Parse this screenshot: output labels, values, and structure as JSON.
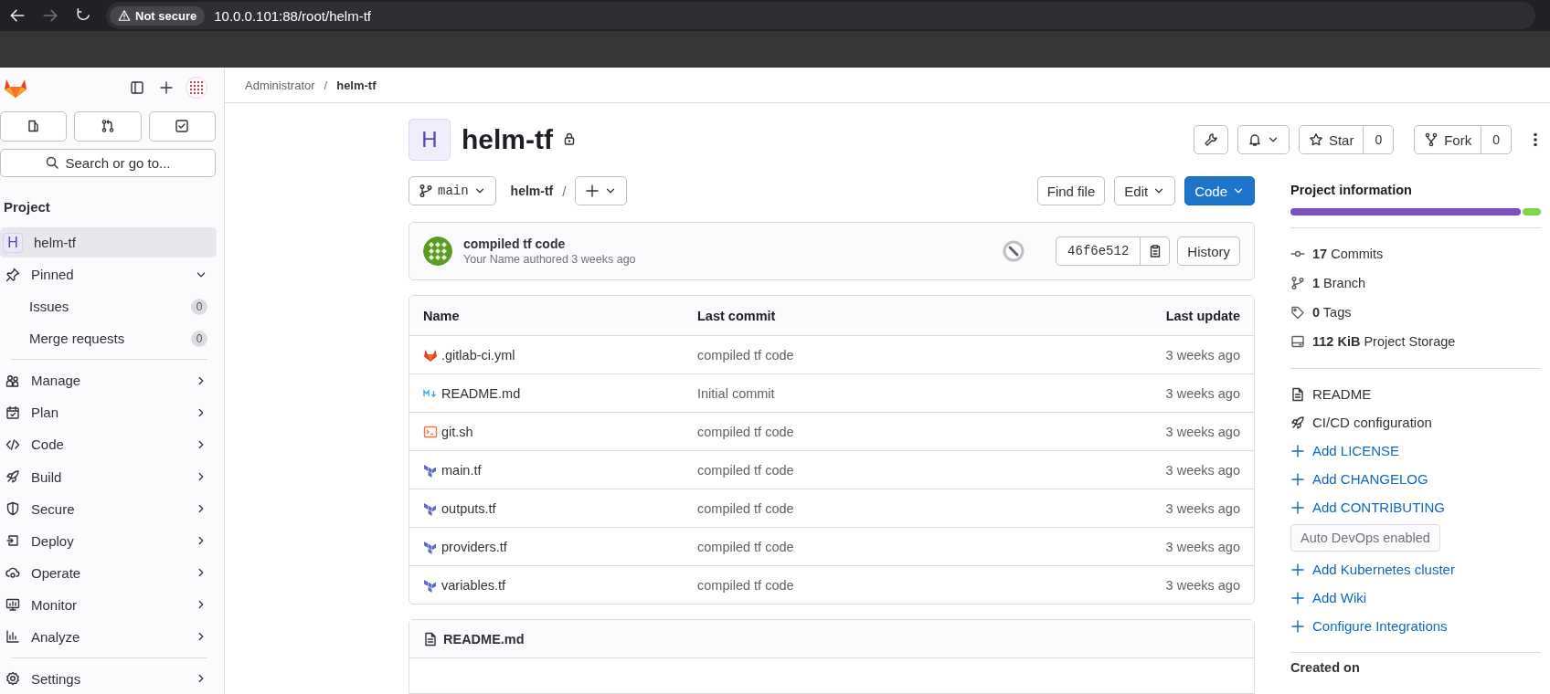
{
  "browser": {
    "nav": [
      {
        "kind": "back",
        "disabled": false
      },
      {
        "kind": "forward",
        "disabled": true
      },
      {
        "kind": "reload",
        "disabled": false
      }
    ],
    "security": "Not secure",
    "url": "10.0.0.101:88/root/helm-tf"
  },
  "sidebar": {
    "search": "Search or go to...",
    "section": "Project",
    "project": {
      "avatar": "H",
      "label": "helm-tf",
      "selected": true
    },
    "pinned": {
      "label": "Pinned",
      "expanded": true,
      "children": [
        {
          "label": "Issues",
          "count": "0"
        },
        {
          "label": "Merge requests",
          "count": "0"
        }
      ]
    },
    "items": [
      {
        "kind": "manage",
        "label": "Manage"
      },
      {
        "kind": "plan",
        "label": "Plan"
      },
      {
        "kind": "code",
        "label": "Code"
      },
      {
        "kind": "build",
        "label": "Build"
      },
      {
        "kind": "secure",
        "label": "Secure"
      },
      {
        "kind": "deploy",
        "label": "Deploy"
      },
      {
        "kind": "operate",
        "label": "Operate"
      },
      {
        "kind": "monitor",
        "label": "Monitor"
      },
      {
        "kind": "analyze",
        "label": "Analyze"
      }
    ],
    "footer": {
      "kind": "settings",
      "label": "Settings"
    }
  },
  "breadcrumb": [
    "Administrator",
    "/",
    "helm-tf"
  ],
  "project": {
    "avatar": "H",
    "name": "helm-tf",
    "private": true,
    "star": {
      "label": "Star",
      "count": "0"
    },
    "fork": {
      "label": "Fork",
      "count": "0"
    }
  },
  "toolbar": {
    "branch": "main",
    "path": "helm-tf",
    "separator": "/",
    "find": "Find file",
    "edit": "Edit",
    "code": "Code"
  },
  "commit": {
    "title": "compiled tf code",
    "meta": "Your Name authored 3 weeks ago",
    "sha": "46f6e512",
    "history": "History"
  },
  "table": {
    "columns": [
      "Name",
      "Last commit",
      "Last update"
    ],
    "rows": [
      {
        "kind": "gitlab",
        "name": ".gitlab-ci.yml",
        "commit": "compiled tf code",
        "updated": "3 weeks ago"
      },
      {
        "kind": "markdown",
        "name": "README.md",
        "commit": "Initial commit",
        "updated": "3 weeks ago"
      },
      {
        "kind": "shell",
        "name": "git.sh",
        "commit": "compiled tf code",
        "updated": "3 weeks ago"
      },
      {
        "kind": "terraform",
        "name": "main.tf",
        "commit": "compiled tf code",
        "updated": "3 weeks ago"
      },
      {
        "kind": "terraform",
        "name": "outputs.tf",
        "commit": "compiled tf code",
        "updated": "3 weeks ago"
      },
      {
        "kind": "terraform",
        "name": "providers.tf",
        "commit": "compiled tf code",
        "updated": "3 weeks ago"
      },
      {
        "kind": "terraform",
        "name": "variables.tf",
        "commit": "compiled tf code",
        "updated": "3 weeks ago"
      }
    ]
  },
  "readme": {
    "title": "README.md"
  },
  "info": {
    "title": "Project information",
    "languages": [
      {
        "color": "#7b4fbd"
      },
      {
        "color": "#7ed34f"
      }
    ],
    "stats": [
      {
        "kind": "commits",
        "text": "**17** Commits"
      },
      {
        "kind": "branch",
        "text": "**1** Branch"
      },
      {
        "kind": "tags",
        "text": "**0** Tags"
      },
      {
        "kind": "storage",
        "text": "**112 KiB** Project Storage"
      }
    ],
    "links": [
      {
        "kind": "readme",
        "label": "README"
      },
      {
        "kind": "cicd",
        "label": "CI/CD configuration"
      },
      {
        "kind": "add",
        "label": "Add LICENSE"
      },
      {
        "kind": "add",
        "label": "Add CHANGELOG"
      },
      {
        "kind": "add",
        "label": "Add CONTRIBUTING"
      },
      {
        "kind": "badge",
        "label": "Auto DevOps enabled"
      },
      {
        "kind": "add",
        "label": "Add Kubernetes cluster"
      },
      {
        "kind": "add",
        "label": "Add Wiki"
      },
      {
        "kind": "add",
        "label": "Configure Integrations"
      }
    ],
    "created": "Created on"
  }
}
